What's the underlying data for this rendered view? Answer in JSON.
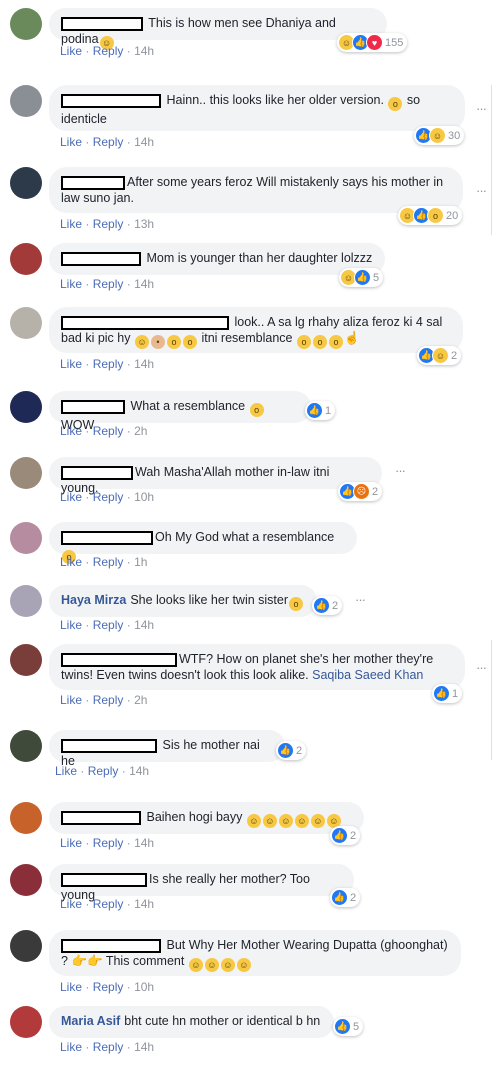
{
  "actions": {
    "like": "Like",
    "reply": "Reply",
    "sep": "·"
  },
  "comments": [
    {
      "author": "",
      "text": "This is how men see Dhaniya and podina",
      "time": "14h",
      "count": "155"
    },
    {
      "author": "",
      "text": "Hainn.. this looks like her older version.",
      "text2": "so identicle",
      "time": "14h",
      "count": "30"
    },
    {
      "author": "",
      "text": "After some years feroz Will mistakenly says his mother in law suno jan.",
      "time": "13h",
      "count": "20"
    },
    {
      "author": "",
      "text": "Mom is younger than her daughter lolzzz",
      "time": "14h",
      "count": "5"
    },
    {
      "author": "",
      "text": "look.. A sa lg rhahy aliza feroz ki 4 sal bad ki pic hy",
      "text2": "itni resemblance",
      "time": "14h",
      "count": "2"
    },
    {
      "author": "",
      "text": "What a resemblance",
      "text2": "WOW",
      "time": "2h",
      "count": "1"
    },
    {
      "author": "",
      "text": "Wah Masha'Allah mother in-law itni young.",
      "time": "10h",
      "count": "2"
    },
    {
      "author": "",
      "text": "Oh My God what a resemblance",
      "time": "1h",
      "count": ""
    },
    {
      "author": "Haya Mirza",
      "text": "She looks like her twin sister",
      "time": "14h",
      "count": "2"
    },
    {
      "author": "",
      "text": "WTF? How on planet she's her mother they're twins! Even twins doesn't look this look alike.",
      "mention": "Saqiba Saeed Khan",
      "time": "2h",
      "count": "1"
    },
    {
      "author": "",
      "text": "Sis he mother nai he",
      "time": "14h",
      "count": "2"
    },
    {
      "author": "",
      "text": "Baihen hogi bayy",
      "time": "14h",
      "count": "2"
    },
    {
      "author": "",
      "text": "Is she really her mother? Too young",
      "time": "14h",
      "count": "2"
    },
    {
      "author": "",
      "text": "But Why Her Mother Wearing Dupatta (ghoonghat) ?",
      "text2": "This comment",
      "time": "10h",
      "count": ""
    },
    {
      "author": "Maria Asif",
      "text": "bht cute hn mother or identical b hn",
      "time": "14h",
      "count": "5"
    }
  ],
  "icons": {
    "more": "more-options-icon",
    "like": "like-reaction-icon",
    "haha": "haha-reaction-icon",
    "wow": "wow-reaction-icon",
    "love": "love-reaction-icon",
    "angry": "angry-reaction-icon"
  }
}
